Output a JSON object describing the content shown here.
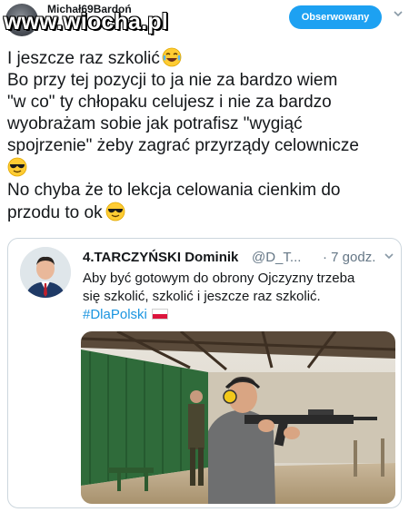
{
  "header": {
    "author_name": "Michał69Bardoń",
    "watermark": "www.wiocha.pl",
    "follow_button": "Obserwowany"
  },
  "tweet": {
    "lines": [
      "I jeszcze raz szkolić",
      "Bo przy tej pozycji to ja nie za bardzo wiem",
      "\"w co\" ty chłopaku celujesz i nie za bardzo",
      "wyobrażam sobie jak potrafisz \"wygiąć",
      "spojrzenie\" żeby zagrać przyrządy celownicze",
      "No chyba że to lekcja celowania cienkim do",
      "przodu to ok"
    ],
    "emojis": [
      "tears-of-joy-emoji",
      "sunglasses-emoji",
      "sunglasses-emoji"
    ]
  },
  "quoted_tweet": {
    "name": "4.TARCZYŃSKI Dominik",
    "handle": "@D_T...",
    "time": "· 7 godz.",
    "lines": [
      "Aby być gotowym do obrony Ojczyzny trzeba",
      "się szkolić, szkolić i jeszcze raz szkolić."
    ],
    "hashtag": "#DlaPolski",
    "flag": "poland-flag",
    "media": "shooting-range-photo"
  },
  "colors": {
    "accent": "#1da1f2",
    "link": "#1b95e0",
    "muted": "#657786"
  }
}
